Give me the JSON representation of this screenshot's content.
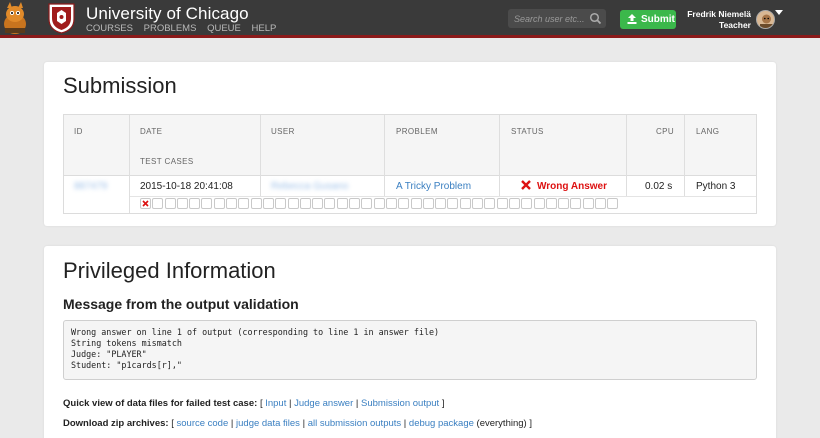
{
  "header": {
    "title": "University of Chicago",
    "nav": [
      "COURSES",
      "PROBLEMS",
      "QUEUE",
      "HELP"
    ],
    "search_placeholder": "Search user etc...",
    "submit_label": "Submit",
    "user_name": "Fredrik Niemelä",
    "user_role": "Teacher"
  },
  "submission": {
    "heading": "Submission",
    "columns": [
      "ID",
      "DATE",
      "USER",
      "PROBLEM",
      "STATUS",
      "CPU",
      "LANG"
    ],
    "test_cases_label": "TEST CASES",
    "row": {
      "id": "887479",
      "date": "2015-10-18 20:41:08",
      "user": "Rebecca Gusano",
      "problem": "A Tricky Problem",
      "status": "Wrong Answer",
      "cpu": "0.02 s",
      "lang": "Python 3"
    },
    "test_cases_total": 39,
    "test_cases_failed": 1
  },
  "privileged": {
    "heading": "Privileged Information",
    "message_heading": "Message from the output validation",
    "message_lines": [
      "Wrong answer on line 1 of output (corresponding to line 1 in answer file)",
      "String tokens mismatch",
      "Judge: \"PLAYER\"",
      "Student: \"p1cards[r],\""
    ],
    "quick_view_label": "Quick view of data files for failed test case:",
    "quick_view_links": [
      "Input",
      "Judge answer",
      "Submission output"
    ],
    "download_label": "Download zip archives:",
    "download_links": [
      "source code",
      "judge data files",
      "all submission outputs",
      "debug package"
    ],
    "download_suffix": "(everything)"
  },
  "colors": {
    "header_bg": "#3a3a3a",
    "header_border": "#8b1a1a",
    "submit_green": "#3bb84b",
    "link_blue": "#3a7fc1",
    "wrong_red": "#dd1111"
  }
}
